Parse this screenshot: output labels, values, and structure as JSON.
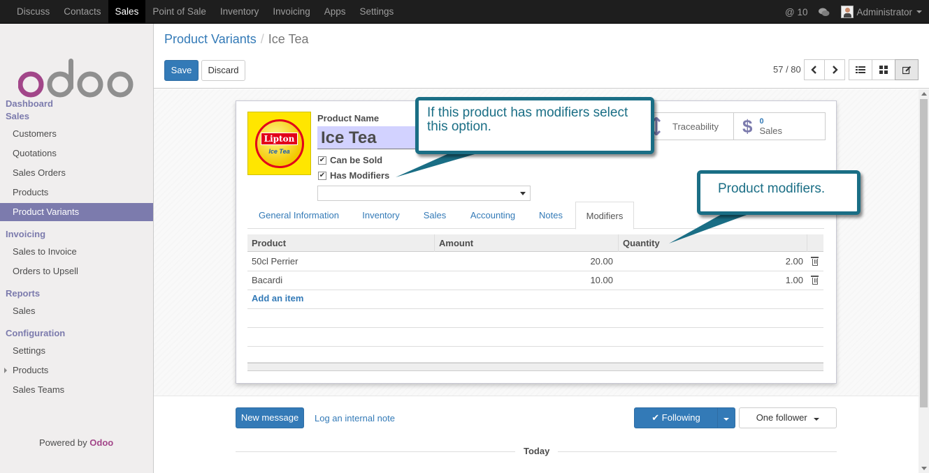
{
  "topnav": {
    "menus": [
      "Discuss",
      "Contacts",
      "Sales",
      "Point of Sale",
      "Inventory",
      "Invoicing",
      "Apps",
      "Settings"
    ],
    "active_menu": "Sales",
    "notifications": "@ 10",
    "user": "Administrator"
  },
  "sidebar": {
    "sections": [
      {
        "title": "Dashboard"
      },
      {
        "title": "Sales",
        "items": [
          "Customers",
          "Quotations",
          "Sales Orders",
          "Products",
          "Product Variants"
        ]
      },
      {
        "title": "Invoicing",
        "items": [
          "Sales to Invoice",
          "Orders to Upsell"
        ]
      },
      {
        "title": "Reports",
        "items": [
          "Sales"
        ]
      },
      {
        "title": "Configuration",
        "items": [
          "Settings",
          "Products",
          "Sales Teams"
        ]
      }
    ],
    "active_item": "Product Variants",
    "powered_by": "Powered by",
    "powered_brand": "Odoo"
  },
  "control": {
    "breadcrumb_parent": "Product Variants",
    "breadcrumb_current": "Ice Tea",
    "save_label": "Save",
    "discard_label": "Discard",
    "pager": "57 / 80"
  },
  "form": {
    "image_brand": "Lipton",
    "image_product": "Ice Tea",
    "name_label": "Product Name",
    "name_value": "Ice Tea",
    "can_be_sold": "Can be Sold",
    "has_modifiers": "Has Modifiers",
    "stat_traceability": "Traceability",
    "stat_sales_count": "0",
    "stat_sales_label": "Sales",
    "tabs": [
      "General Information",
      "Inventory",
      "Sales",
      "Accounting",
      "Notes",
      "Modifiers"
    ],
    "active_tab": "Modifiers",
    "grid_headers": [
      "Product",
      "Amount",
      "Quantity"
    ],
    "rows": [
      {
        "product": "50cl Perrier",
        "amount": "20.00",
        "quantity": "2.00"
      },
      {
        "product": "Bacardi",
        "amount": "10.00",
        "quantity": "1.00"
      }
    ],
    "add_item": "Add an item"
  },
  "chatter": {
    "new_message": "New message",
    "log_note": "Log an internal note",
    "following": "Following",
    "followers": "One follower",
    "today": "Today"
  },
  "callouts": {
    "modifiers_option": "If this product has modifiers select this option.",
    "product_modifiers": "Product modifiers."
  },
  "colors": {
    "brand": "#7c7bad",
    "primary": "#337ab7",
    "callout": "#1a6e85"
  }
}
